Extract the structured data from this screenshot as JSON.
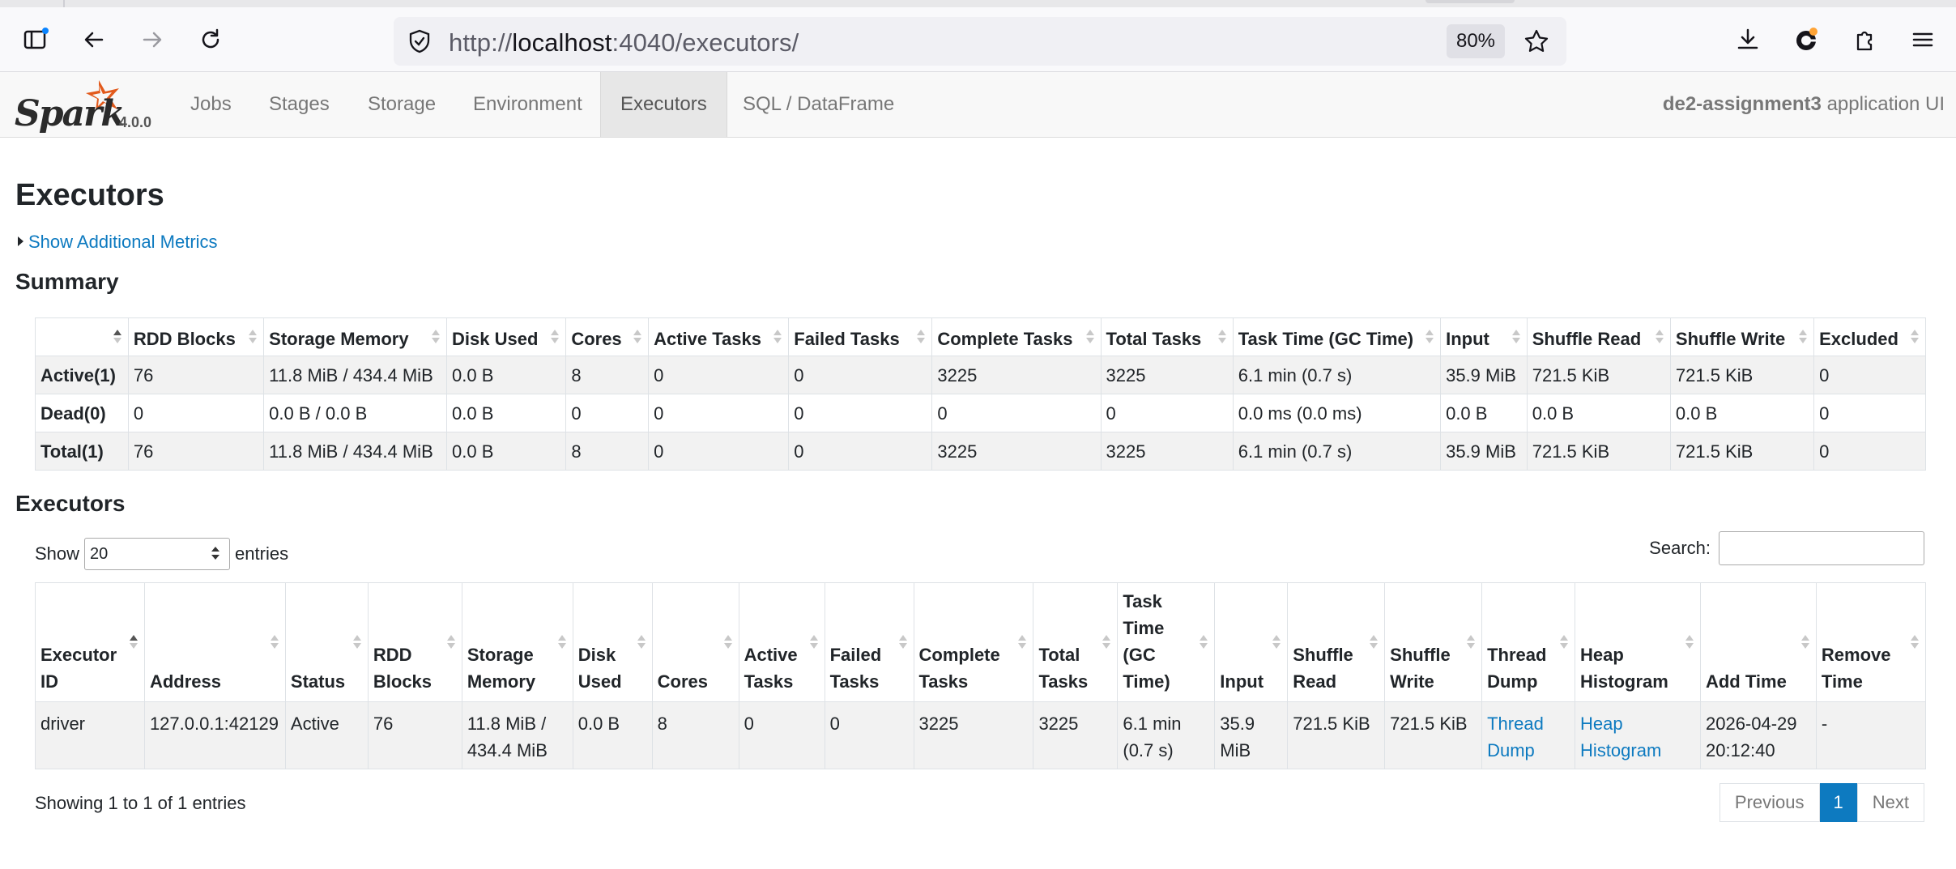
{
  "browser": {
    "url_scheme": "http://",
    "url_host": "localhost",
    "url_path": ":4040/executors/",
    "zoom": "80%"
  },
  "nav": {
    "version": "4.0.0",
    "tabs": [
      {
        "label": "Jobs"
      },
      {
        "label": "Stages"
      },
      {
        "label": "Storage"
      },
      {
        "label": "Environment"
      },
      {
        "label": "Executors",
        "active": true
      },
      {
        "label": "SQL / DataFrame"
      }
    ],
    "app_name": "de2-assignment3",
    "app_suffix": " application UI"
  },
  "page": {
    "title": "Executors",
    "additional_metrics": "Show Additional Metrics",
    "summary_title": "Summary",
    "executors_title": "Executors"
  },
  "summary": {
    "headers": [
      "",
      "RDD Blocks",
      "Storage Memory",
      "Disk Used",
      "Cores",
      "Active Tasks",
      "Failed Tasks",
      "Complete Tasks",
      "Total Tasks",
      "Task Time (GC Time)",
      "Input",
      "Shuffle Read",
      "Shuffle Write",
      "Excluded"
    ],
    "rows": [
      [
        "Active(1)",
        "76",
        "11.8 MiB / 434.4 MiB",
        "0.0 B",
        "8",
        "0",
        "0",
        "3225",
        "3225",
        "6.1 min (0.7 s)",
        "35.9 MiB",
        "721.5 KiB",
        "721.5 KiB",
        "0"
      ],
      [
        "Dead(0)",
        "0",
        "0.0 B / 0.0 B",
        "0.0 B",
        "0",
        "0",
        "0",
        "0",
        "0",
        "0.0 ms (0.0 ms)",
        "0.0 B",
        "0.0 B",
        "0.0 B",
        "0"
      ],
      [
        "Total(1)",
        "76",
        "11.8 MiB / 434.4 MiB",
        "0.0 B",
        "8",
        "0",
        "0",
        "3225",
        "3225",
        "6.1 min (0.7 s)",
        "35.9 MiB",
        "721.5 KiB",
        "721.5 KiB",
        "0"
      ]
    ]
  },
  "controls": {
    "show_label": "Show",
    "page_size": "20",
    "entries_label": "entries",
    "search_label": "Search:",
    "search_value": ""
  },
  "executors": {
    "headers": [
      [
        "Executor",
        "ID"
      ],
      [
        "Address"
      ],
      [
        "Status"
      ],
      [
        "RDD",
        "Blocks"
      ],
      [
        "Storage",
        "Memory"
      ],
      [
        "Disk",
        "Used"
      ],
      [
        "Cores"
      ],
      [
        "Active",
        "Tasks"
      ],
      [
        "Failed",
        "Tasks"
      ],
      [
        "Complete",
        "Tasks"
      ],
      [
        "Total",
        "Tasks"
      ],
      [
        "Task",
        "Time",
        "(GC",
        "Time)"
      ],
      [
        "Input"
      ],
      [
        "Shuffle",
        "Read"
      ],
      [
        "Shuffle",
        "Write"
      ],
      [
        "Thread",
        "Dump"
      ],
      [
        "Heap",
        "Histogram"
      ],
      [
        "Add Time"
      ],
      [
        "Remove",
        "Time"
      ]
    ],
    "rows": [
      {
        "executor_id": "driver",
        "address": "127.0.0.1:42129",
        "status": "Active",
        "rdd_blocks": "76",
        "storage_memory": [
          "11.8 MiB /",
          "434.4 MiB"
        ],
        "disk_used": "0.0 B",
        "cores": "8",
        "active_tasks": "0",
        "failed_tasks": "0",
        "complete_tasks": "3225",
        "total_tasks": "3225",
        "task_time": [
          "6.1 min",
          "(0.7 s)"
        ],
        "input": [
          "35.9",
          "MiB"
        ],
        "shuffle_read": "721.5 KiB",
        "shuffle_write": "721.5 KiB",
        "thread_dump": [
          "Thread",
          "Dump"
        ],
        "heap_histogram": [
          "Heap",
          "Histogram"
        ],
        "add_time": [
          "2026-04-29",
          "20:12:40"
        ],
        "remove_time": "-"
      }
    ]
  },
  "footer": {
    "showing": "Showing 1 to 1 of 1 entries",
    "previous": "Previous",
    "current_page": "1",
    "next": "Next"
  },
  "colors": {
    "link": "#0d7ac0",
    "spark_orange": "#e25a1c"
  }
}
